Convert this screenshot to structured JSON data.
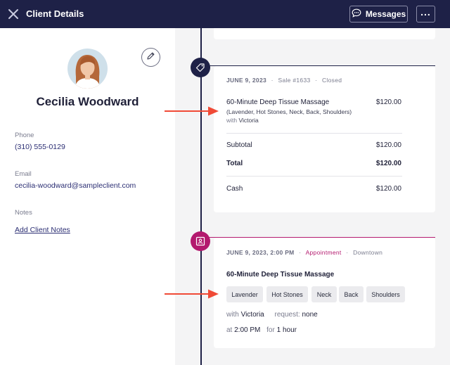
{
  "header": {
    "title": "Client Details",
    "messages_label": "Messages",
    "more_label": "..."
  },
  "client": {
    "name": "Cecilia Woodward",
    "phone_label": "Phone",
    "phone": "(310) 555-0129",
    "email_label": "Email",
    "email": "cecilia-woodward@sampleclient.com",
    "notes_label": "Notes",
    "add_notes": "Add Client Notes"
  },
  "sale": {
    "date": "JUNE 9, 2023",
    "sep1": "·",
    "sale_no": "Sale #1633",
    "sep2": "·",
    "status": "Closed",
    "service": "60-Minute Deep Tissue Massage",
    "service_price": "$120.00",
    "addons": "(Lavender, Hot Stones, Neck, Back, Shoulders)",
    "with_label": "with",
    "staff": "Victoria",
    "subtotal_label": "Subtotal",
    "subtotal": "$120.00",
    "total_label": "Total",
    "total": "$120.00",
    "cash_label": "Cash",
    "cash": "$120.00"
  },
  "appointment": {
    "datetime": "JUNE 9, 2023, 2:00 PM",
    "sep1": "·",
    "type": "Appointment",
    "sep2": "·",
    "location": "Downtown",
    "service": "60-Minute Deep Tissue Massage",
    "chips": [
      "Lavender",
      "Hot Stones",
      "Neck",
      "Back",
      "Shoulders"
    ],
    "with_label": "with",
    "staff": "Victoria",
    "request_label": "request:",
    "request": "none",
    "at_label": "at",
    "time": "2:00 PM",
    "for_label": "for",
    "duration": "1 hour"
  },
  "icons": {
    "close": "close-icon",
    "messages": "chat-bubble-icon",
    "edit": "pencil-icon",
    "sale_node": "tag-icon",
    "appt_node": "calendar-person-icon"
  },
  "colors": {
    "navy": "#1e2147",
    "appointment_accent": "#b3196e",
    "arrow": "#f04a36",
    "link": "#2b2e73"
  }
}
